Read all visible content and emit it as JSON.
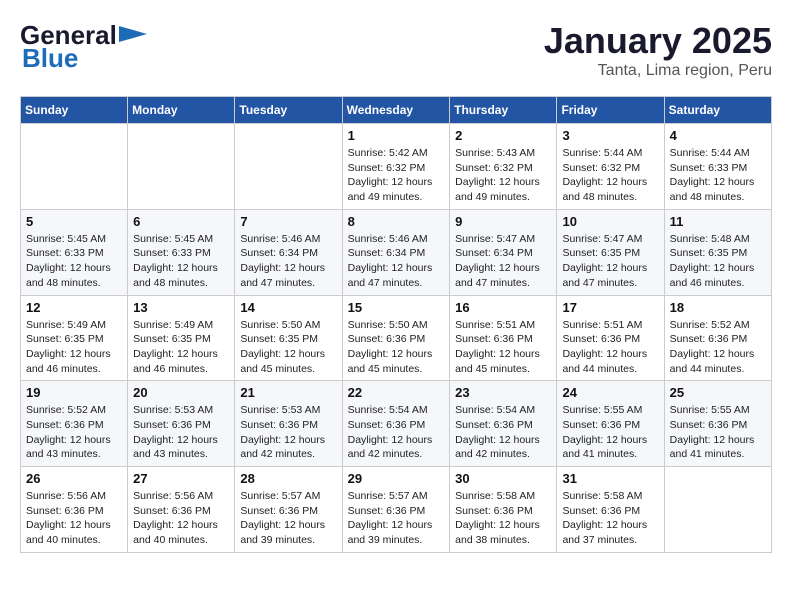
{
  "header": {
    "logo_general": "General",
    "logo_blue": "Blue",
    "month": "January 2025",
    "location": "Tanta, Lima region, Peru"
  },
  "days_of_week": [
    "Sunday",
    "Monday",
    "Tuesday",
    "Wednesday",
    "Thursday",
    "Friday",
    "Saturday"
  ],
  "weeks": [
    [
      {
        "day": "",
        "info": ""
      },
      {
        "day": "",
        "info": ""
      },
      {
        "day": "",
        "info": ""
      },
      {
        "day": "1",
        "info": "Sunrise: 5:42 AM\nSunset: 6:32 PM\nDaylight: 12 hours\nand 49 minutes."
      },
      {
        "day": "2",
        "info": "Sunrise: 5:43 AM\nSunset: 6:32 PM\nDaylight: 12 hours\nand 49 minutes."
      },
      {
        "day": "3",
        "info": "Sunrise: 5:44 AM\nSunset: 6:32 PM\nDaylight: 12 hours\nand 48 minutes."
      },
      {
        "day": "4",
        "info": "Sunrise: 5:44 AM\nSunset: 6:33 PM\nDaylight: 12 hours\nand 48 minutes."
      }
    ],
    [
      {
        "day": "5",
        "info": "Sunrise: 5:45 AM\nSunset: 6:33 PM\nDaylight: 12 hours\nand 48 minutes."
      },
      {
        "day": "6",
        "info": "Sunrise: 5:45 AM\nSunset: 6:33 PM\nDaylight: 12 hours\nand 48 minutes."
      },
      {
        "day": "7",
        "info": "Sunrise: 5:46 AM\nSunset: 6:34 PM\nDaylight: 12 hours\nand 47 minutes."
      },
      {
        "day": "8",
        "info": "Sunrise: 5:46 AM\nSunset: 6:34 PM\nDaylight: 12 hours\nand 47 minutes."
      },
      {
        "day": "9",
        "info": "Sunrise: 5:47 AM\nSunset: 6:34 PM\nDaylight: 12 hours\nand 47 minutes."
      },
      {
        "day": "10",
        "info": "Sunrise: 5:47 AM\nSunset: 6:35 PM\nDaylight: 12 hours\nand 47 minutes."
      },
      {
        "day": "11",
        "info": "Sunrise: 5:48 AM\nSunset: 6:35 PM\nDaylight: 12 hours\nand 46 minutes."
      }
    ],
    [
      {
        "day": "12",
        "info": "Sunrise: 5:49 AM\nSunset: 6:35 PM\nDaylight: 12 hours\nand 46 minutes."
      },
      {
        "day": "13",
        "info": "Sunrise: 5:49 AM\nSunset: 6:35 PM\nDaylight: 12 hours\nand 46 minutes."
      },
      {
        "day": "14",
        "info": "Sunrise: 5:50 AM\nSunset: 6:35 PM\nDaylight: 12 hours\nand 45 minutes."
      },
      {
        "day": "15",
        "info": "Sunrise: 5:50 AM\nSunset: 6:36 PM\nDaylight: 12 hours\nand 45 minutes."
      },
      {
        "day": "16",
        "info": "Sunrise: 5:51 AM\nSunset: 6:36 PM\nDaylight: 12 hours\nand 45 minutes."
      },
      {
        "day": "17",
        "info": "Sunrise: 5:51 AM\nSunset: 6:36 PM\nDaylight: 12 hours\nand 44 minutes."
      },
      {
        "day": "18",
        "info": "Sunrise: 5:52 AM\nSunset: 6:36 PM\nDaylight: 12 hours\nand 44 minutes."
      }
    ],
    [
      {
        "day": "19",
        "info": "Sunrise: 5:52 AM\nSunset: 6:36 PM\nDaylight: 12 hours\nand 43 minutes."
      },
      {
        "day": "20",
        "info": "Sunrise: 5:53 AM\nSunset: 6:36 PM\nDaylight: 12 hours\nand 43 minutes."
      },
      {
        "day": "21",
        "info": "Sunrise: 5:53 AM\nSunset: 6:36 PM\nDaylight: 12 hours\nand 42 minutes."
      },
      {
        "day": "22",
        "info": "Sunrise: 5:54 AM\nSunset: 6:36 PM\nDaylight: 12 hours\nand 42 minutes."
      },
      {
        "day": "23",
        "info": "Sunrise: 5:54 AM\nSunset: 6:36 PM\nDaylight: 12 hours\nand 42 minutes."
      },
      {
        "day": "24",
        "info": "Sunrise: 5:55 AM\nSunset: 6:36 PM\nDaylight: 12 hours\nand 41 minutes."
      },
      {
        "day": "25",
        "info": "Sunrise: 5:55 AM\nSunset: 6:36 PM\nDaylight: 12 hours\nand 41 minutes."
      }
    ],
    [
      {
        "day": "26",
        "info": "Sunrise: 5:56 AM\nSunset: 6:36 PM\nDaylight: 12 hours\nand 40 minutes."
      },
      {
        "day": "27",
        "info": "Sunrise: 5:56 AM\nSunset: 6:36 PM\nDaylight: 12 hours\nand 40 minutes."
      },
      {
        "day": "28",
        "info": "Sunrise: 5:57 AM\nSunset: 6:36 PM\nDaylight: 12 hours\nand 39 minutes."
      },
      {
        "day": "29",
        "info": "Sunrise: 5:57 AM\nSunset: 6:36 PM\nDaylight: 12 hours\nand 39 minutes."
      },
      {
        "day": "30",
        "info": "Sunrise: 5:58 AM\nSunset: 6:36 PM\nDaylight: 12 hours\nand 38 minutes."
      },
      {
        "day": "31",
        "info": "Sunrise: 5:58 AM\nSunset: 6:36 PM\nDaylight: 12 hours\nand 37 minutes."
      },
      {
        "day": "",
        "info": ""
      }
    ]
  ]
}
